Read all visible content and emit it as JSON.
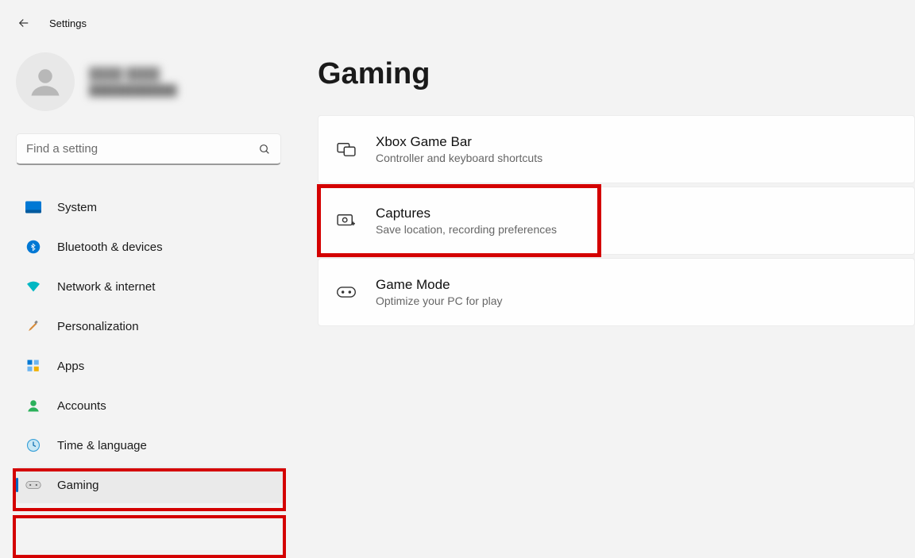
{
  "app": {
    "title": "Settings"
  },
  "profile": {
    "name": "████ ████",
    "email": "████████████"
  },
  "search": {
    "placeholder": "Find a setting"
  },
  "sidebar": {
    "items": [
      {
        "label": "System"
      },
      {
        "label": "Bluetooth & devices"
      },
      {
        "label": "Network & internet"
      },
      {
        "label": "Personalization"
      },
      {
        "label": "Apps"
      },
      {
        "label": "Accounts"
      },
      {
        "label": "Time & language"
      },
      {
        "label": "Gaming"
      }
    ]
  },
  "page": {
    "title": "Gaming",
    "cards": [
      {
        "title": "Xbox Game Bar",
        "sub": "Controller and keyboard shortcuts"
      },
      {
        "title": "Captures",
        "sub": "Save location, recording preferences"
      },
      {
        "title": "Game Mode",
        "sub": "Optimize your PC for play"
      }
    ]
  }
}
